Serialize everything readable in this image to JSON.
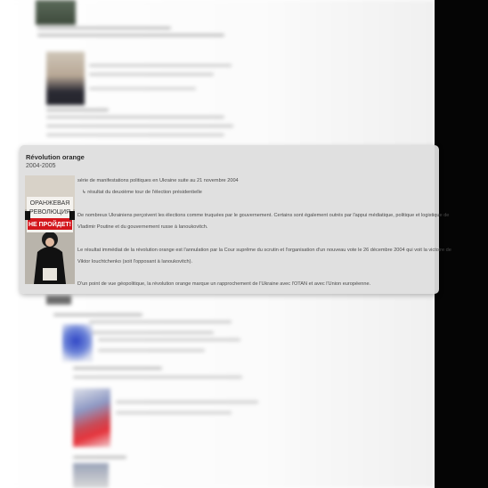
{
  "event": {
    "title": "Révolution orange",
    "dates": "2004-2005",
    "summary": "série de manifestations politiques en Ukraine suite au 21 novembre 2004",
    "sub_item": "↳ résultat du deuxième tour de l'élection présidentielle",
    "paragraph1_line1": "De nombreux Ukrainiens perçoivent les élections comme truquées par le gouvernement. Certains sont également outrés par l'appui médiatique, politique et logistique de",
    "paragraph1_line2": "Vladimir Poutine et du gouvernement russe à Ianoukovitch.",
    "paragraph2_line1": "Le résultat immédiat de la révolution orange est l'annulation par la Cour suprême du scrutin et l'organisation d'un nouveau vote le 26 décembre 2004 qui voit la victoire de",
    "paragraph2_line2": "Viktor Iouchtchenko (soit l'opposant à Ianoukovitch).",
    "paragraph3": "D'un point de vue géopolitique, la révolution orange marque un rapprochement de l'Ukraine avec l'OTAN et avec l'Union européenne.",
    "photo_sign": {
      "line1": "ОРАНЖЕВАЯ",
      "line2": "РЕВОЛЮЦИЯ",
      "line3": "НЕ ПРОЙДЕТ!"
    }
  },
  "colors": {
    "card_bg": "#dedede",
    "side_bar": "#050505",
    "sign_red": "#d3161c"
  }
}
